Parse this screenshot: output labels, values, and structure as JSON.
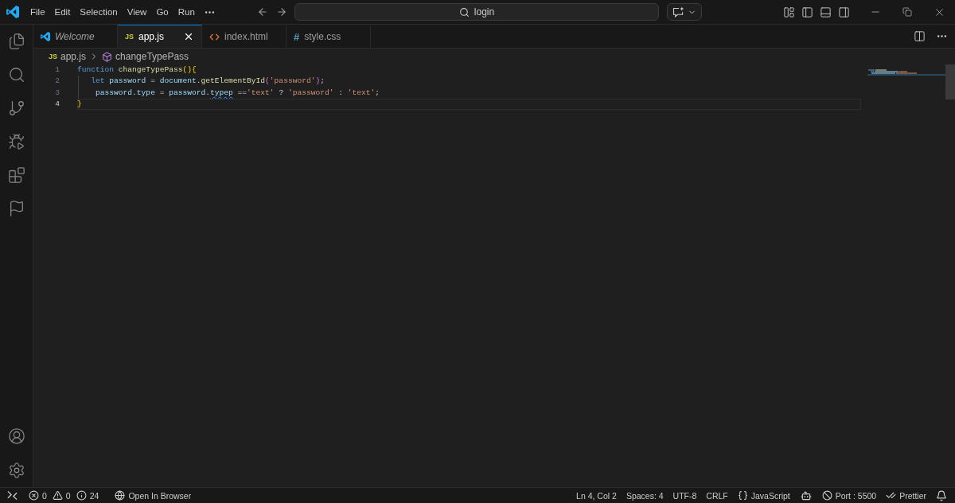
{
  "title_bar": {
    "menus": [
      "File",
      "Edit",
      "Selection",
      "View",
      "Go",
      "Run"
    ],
    "command_center": "login"
  },
  "tabs": [
    {
      "kind": "welcome",
      "label": "Welcome",
      "preview": true,
      "selected": false
    },
    {
      "kind": "js",
      "icon_text": "JS",
      "label": "app.js",
      "preview": false,
      "selected": true
    },
    {
      "kind": "html",
      "label": "index.html",
      "preview": false,
      "selected": false
    },
    {
      "kind": "css",
      "icon_text": "#",
      "label": "style.css",
      "preview": false,
      "selected": false
    }
  ],
  "breadcrumb": {
    "file_icon_text": "JS",
    "file": "app.js",
    "symbol": "changeTypePass"
  },
  "editor": {
    "lines": [
      {
        "number": "1",
        "current": false,
        "indent_guide": false,
        "tokens": [
          {
            "kind": "keyword",
            "text": "function "
          },
          {
            "kind": "function",
            "text": "changeTypePass"
          },
          {
            "kind": "bracket_gold",
            "text": "(){"
          }
        ]
      },
      {
        "number": "2",
        "current": false,
        "indent_guide": true,
        "tokens": [
          {
            "kind": "keyword",
            "text": "   let "
          },
          {
            "kind": "variable",
            "text": "password"
          },
          {
            "kind": "plain",
            "text": " = "
          },
          {
            "kind": "variable",
            "text": "document"
          },
          {
            "kind": "plain",
            "text": "."
          },
          {
            "kind": "function",
            "text": "getElementById"
          },
          {
            "kind": "bracket_purple",
            "text": "("
          },
          {
            "kind": "string",
            "text": "'password'"
          },
          {
            "kind": "bracket_purple",
            "text": ")"
          },
          {
            "kind": "plain",
            "text": ";"
          }
        ]
      },
      {
        "number": "3",
        "current": false,
        "indent_guide": true,
        "tokens": [
          {
            "kind": "variable",
            "text": "    password"
          },
          {
            "kind": "plain",
            "text": "."
          },
          {
            "kind": "variable",
            "text": "type"
          },
          {
            "kind": "plain",
            "text": " = "
          },
          {
            "kind": "variable",
            "text": "password"
          },
          {
            "kind": "plain",
            "text": "."
          },
          {
            "kind": "unresolved",
            "text": "typep"
          },
          {
            "kind": "plain",
            "text": " =="
          },
          {
            "kind": "string",
            "text": "'text'"
          },
          {
            "kind": "plain",
            "text": " ? "
          },
          {
            "kind": "string",
            "text": "'password'"
          },
          {
            "kind": "plain",
            "text": " : "
          },
          {
            "kind": "string",
            "text": "'text'"
          },
          {
            "kind": "plain",
            "text": ";"
          }
        ]
      },
      {
        "number": "4",
        "current": true,
        "indent_guide": false,
        "tokens": [
          {
            "kind": "bracket_gold",
            "text": "}"
          }
        ]
      }
    ]
  },
  "status_bar": {
    "errors": "0",
    "warnings": "0",
    "infos": "24",
    "open_in_browser": "Open In Browser",
    "cursor": "Ln 4, Col 2",
    "indentation": "Spaces: 4",
    "encoding": "UTF-8",
    "line_ending": "CRLF",
    "language": "JavaScript",
    "port": "Port : 5500",
    "formatter": "Prettier"
  }
}
